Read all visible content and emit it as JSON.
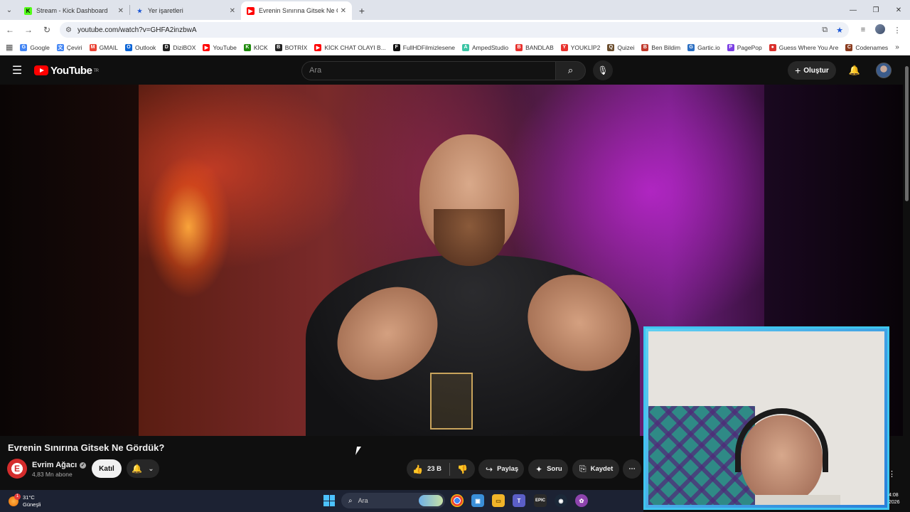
{
  "browser": {
    "tabs": [
      {
        "title": "Stream - Kick Dashboard",
        "favicon": "kick-icon",
        "color": "#53fc18",
        "glyph": "K",
        "active": false
      },
      {
        "title": "Yer işaretleri",
        "favicon": "star-icon",
        "color": "#1a56d6",
        "glyph": "★",
        "active": false
      },
      {
        "title": "Evrenin Sınırına Gitsek Ne Gördü",
        "favicon": "youtube-icon",
        "color": "#ff0000",
        "glyph": "▶",
        "active": true
      }
    ],
    "url": "youtube.com/watch?v=GHFA2inzbwA",
    "bookmarks": [
      {
        "label": "Google",
        "icon": "google-icon",
        "color": "#4285f4",
        "glyph": "G"
      },
      {
        "label": "Çeviri",
        "icon": "translate-icon",
        "color": "#4285f4",
        "glyph": "文"
      },
      {
        "label": "GMAIL",
        "icon": "gmail-icon",
        "color": "#ea4335",
        "glyph": "M"
      },
      {
        "label": "Outlook",
        "icon": "outlook-icon",
        "color": "#0a64d6",
        "glyph": "O"
      },
      {
        "label": "DiziBOX",
        "icon": "dizibox-icon",
        "color": "#222222",
        "glyph": "D"
      },
      {
        "label": "YouTube",
        "icon": "youtube-icon",
        "color": "#ff0000",
        "glyph": "▶"
      },
      {
        "label": "KİCK",
        "icon": "kick-icon",
        "color": "#1f8a0c",
        "glyph": "K"
      },
      {
        "label": "BOTRİX",
        "icon": "botrix-icon",
        "color": "#222222",
        "glyph": "B"
      },
      {
        "label": "KİCK CHAT OLAYI B...",
        "icon": "youtube-icon",
        "color": "#ff0000",
        "glyph": "▶"
      },
      {
        "label": "FullHDFilmizlesene",
        "icon": "film-icon",
        "color": "#111111",
        "glyph": "F"
      },
      {
        "label": "AmpedStudio",
        "icon": "amped-icon",
        "color": "#3bc4a4",
        "glyph": "A"
      },
      {
        "label": "BANDLAB",
        "icon": "bandlab-icon",
        "color": "#e8322e",
        "glyph": "B"
      },
      {
        "label": "YOUKLİP2",
        "icon": "youklip-icon",
        "color": "#e8322e",
        "glyph": "Y"
      },
      {
        "label": "Quizei",
        "icon": "quizei-icon",
        "color": "#6b4e2e",
        "glyph": "Q"
      },
      {
        "label": "Ben Bildim",
        "icon": "benbildim-icon",
        "color": "#c0392b",
        "glyph": "B"
      },
      {
        "label": "Gartic.io",
        "icon": "gartic-icon",
        "color": "#2b6fc2",
        "glyph": "G"
      },
      {
        "label": "PagePop",
        "icon": "pagepop-icon",
        "color": "#7b3fe4",
        "glyph": "P"
      },
      {
        "label": "Guess Where You Are",
        "icon": "pin-icon",
        "color": "#d9302c",
        "glyph": "●"
      },
      {
        "label": "Codenames",
        "icon": "codenames-icon",
        "color": "#8a3b1e",
        "glyph": "C"
      }
    ]
  },
  "youtube": {
    "logo_text": "YouTube",
    "region": "TR",
    "search_placeholder": "Ara",
    "create_label": "Oluştur",
    "video_title": "Evrenin Sınırına Gitsek Ne Gördük?",
    "channel": {
      "name": "Evrim Ağacı",
      "subscribers": "4,83 Mn abone",
      "avatar_glyph": "E"
    },
    "join_label": "Katıl",
    "like_count": "23 B",
    "share_label": "Paylaş",
    "ask_label": "Soru",
    "save_label": "Kaydet"
  },
  "taskbar": {
    "weather_temp": "31°C",
    "weather_desc": "Güneşli",
    "weather_badge": "1",
    "search_placeholder": "Ara",
    "time": "4:08",
    "year": "2026"
  },
  "colors": {
    "accent": "#ff0000",
    "webcam_border": "#3ec6f0"
  }
}
